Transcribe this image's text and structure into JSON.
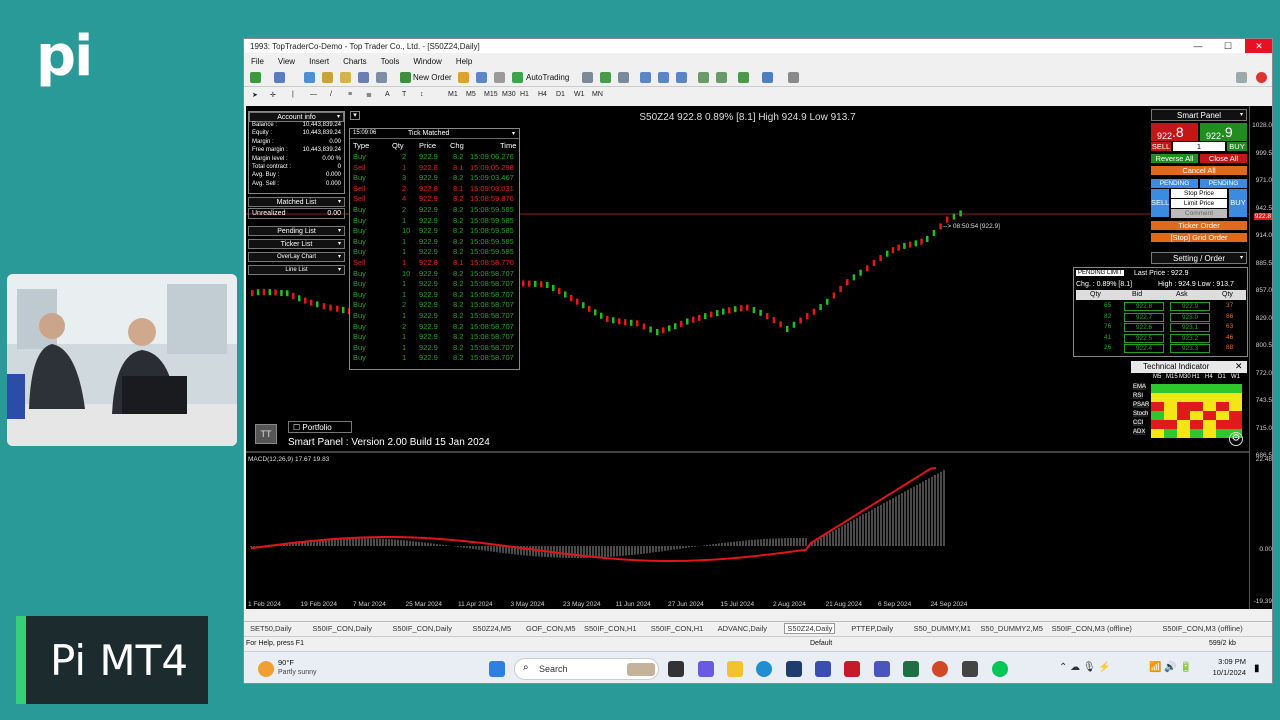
{
  "brand": {
    "logo": "pi",
    "show": "Pi MT4"
  },
  "window": {
    "title": "1993: TopTraderCo-Demo - Top Trader Co., Ltd. - [S50Z24,Daily]",
    "min": "—",
    "max": "☐",
    "close": "✕"
  },
  "menu": [
    "File",
    "View",
    "Insert",
    "Charts",
    "Tools",
    "Window",
    "Help"
  ],
  "toolbar": {
    "new_order": "New Order",
    "autotrading": "AutoTrading",
    "timeframes": [
      "M1",
      "M5",
      "M15",
      "M30",
      "H1",
      "H4",
      "D1",
      "W1",
      "MN"
    ]
  },
  "chart": {
    "header": "S50Z24 922.8 0.89% [8.1] High 924.9 Low 913.7",
    "price_scale": [
      "1028.0",
      "999.5",
      "971.0",
      "942.5",
      "914.0",
      "885.5",
      "857.0",
      "829.0",
      "800.5",
      "772.0",
      "743.5",
      "715.0",
      "686.5"
    ],
    "indicator_scale": [
      "22.48",
      "0.00",
      "-19.39"
    ],
    "current_price_label": "922.8",
    "time_label": "--> 08:50:54 [922.9]",
    "macd_label": "MACD(12,26,9) 17.67 19.83",
    "date_axis": [
      "1 Feb 2024",
      "19 Feb 2024",
      "7 Mar 2024",
      "25 Mar 2024",
      "11 Apr 2024",
      "3 May 2024",
      "23 May 2024",
      "11 Jun 2024",
      "27 Jun 2024",
      "15 Jul 2024",
      "2 Aug 2024",
      "21 Aug 2024",
      "6 Sep 2024",
      "24 Sep 2024"
    ],
    "portfolio": "Portfolio",
    "version": "Smart Panel : Version 2.00 Build 15 Jan 2024"
  },
  "account": {
    "title": "Account info",
    "rows": [
      [
        "Balance :",
        "10,443,839.24"
      ],
      [
        "Equity :",
        "10,443,839.24"
      ],
      [
        "Margin :",
        "0.00"
      ],
      [
        "Free margin :",
        "10,443,839.24"
      ],
      [
        "Margin level :",
        "0.00 %"
      ],
      [
        "Total contract :",
        "0"
      ],
      [
        "Avg. Buy :",
        "0.000"
      ],
      [
        "Avg. Sell :",
        "0.000"
      ]
    ],
    "matched": "Matched List",
    "unrealized": "Unrealized",
    "unrealized_val": "0.00",
    "pending": "Pending List",
    "ticker": "Ticker List",
    "overlay": "OverLay Chart",
    "line": "Line List"
  },
  "tick": {
    "time": "15:09:06",
    "title": "Tick Matched",
    "headers": [
      "Type",
      "Qty",
      "Price",
      "Chg",
      "Time"
    ],
    "rows": [
      [
        "Buy",
        "2",
        "922.9",
        "8.2",
        "15:09:06.276"
      ],
      [
        "Sell",
        "1",
        "922.8",
        "8.1",
        "15:09:05.298"
      ],
      [
        "Buy",
        "3",
        "922.9",
        "8.2",
        "15:09:03.467"
      ],
      [
        "Sell",
        "2",
        "922.8",
        "8.1",
        "15:09:03.031"
      ],
      [
        "Sell",
        "4",
        "922.9",
        "8.2",
        "15:08:59.876"
      ],
      [
        "Buy",
        "2",
        "922.9",
        "8.2",
        "15:08:59.585"
      ],
      [
        "Buy",
        "1",
        "922.9",
        "8.2",
        "15:08:59.585"
      ],
      [
        "Buy",
        "10",
        "922.9",
        "8.2",
        "15:08:59.585"
      ],
      [
        "Buy",
        "1",
        "922.9",
        "8.2",
        "15:08:59.585"
      ],
      [
        "Buy",
        "1",
        "922.9",
        "8.2",
        "15:08:59.585"
      ],
      [
        "Sell",
        "1",
        "922.8",
        "8.1",
        "15:08:58.770"
      ],
      [
        "Buy",
        "10",
        "922.9",
        "8.2",
        "15:08:58.707"
      ],
      [
        "Buy",
        "1",
        "922.9",
        "8.2",
        "15:08:58.707"
      ],
      [
        "Buy",
        "1",
        "922.9",
        "8.2",
        "15:08:58.707"
      ],
      [
        "Buy",
        "2",
        "922.9",
        "8.2",
        "15:08:58.707"
      ],
      [
        "Buy",
        "1",
        "922.9",
        "8.2",
        "15:08:58.707"
      ],
      [
        "Buy",
        "2",
        "922.9",
        "8.2",
        "15:08:58.707"
      ],
      [
        "Buy",
        "1",
        "922.9",
        "8.2",
        "15:08:58.707"
      ],
      [
        "Buy",
        "1",
        "922.9",
        "8.2",
        "15:08:58.707"
      ],
      [
        "Buy",
        "1",
        "922.9",
        "8.2",
        "15:08:58.707"
      ]
    ]
  },
  "smart": {
    "title": "Smart Panel",
    "sell_price": "922",
    "sell_big": ".8",
    "buy_price": "922",
    "buy_big": ".9",
    "sell": "SELL",
    "buy": "BUY",
    "qty": "1",
    "reverse": "Reverse All",
    "close_all": "Close All",
    "cancel_all": "Cancel All",
    "pending": "PENDING",
    "stop_price": "Stop Price",
    "limit_price": "Limit Price",
    "comment": "Comment",
    "ticker_order": "Ticker Order",
    "grid_order": "[Stop] Grid Order",
    "setting": "Setting / Order"
  },
  "depth": {
    "pending": "PENDING LIMIT",
    "last": "Last Price : 922.9",
    "chg": "Chg. : 0.89% [8.1]",
    "hl": "High : 924.9 Low : 913.7",
    "headers": [
      "Qty",
      "Bid",
      "Ask",
      "Qty"
    ],
    "rows": [
      [
        "65",
        "922.8",
        "922.9",
        "37"
      ],
      [
        "82",
        "922.7",
        "923.0",
        "86"
      ],
      [
        "76",
        "922.6",
        "923.1",
        "63"
      ],
      [
        "41",
        "922.5",
        "923.2",
        "46"
      ],
      [
        "26",
        "922.4",
        "923.3",
        "88"
      ]
    ]
  },
  "tech": {
    "title": "Technical Indicator",
    "tfs": [
      "M5",
      "M15",
      "M30",
      "H1",
      "H4",
      "D1",
      "W1"
    ],
    "rows": [
      "EMA",
      "RSI",
      "PSAR",
      "Stoch",
      "CCI",
      "ADX"
    ],
    "grid": [
      [
        "g",
        "g",
        "g",
        "g",
        "g",
        "g",
        "g"
      ],
      [
        "y",
        "y",
        "y",
        "y",
        "y",
        "y",
        "y"
      ],
      [
        "r",
        "y",
        "r",
        "r",
        "y",
        "r",
        "y"
      ],
      [
        "g",
        "y",
        "r",
        "y",
        "r",
        "y",
        "r"
      ],
      [
        "r",
        "r",
        "y",
        "r",
        "y",
        "r",
        "r"
      ],
      [
        "y",
        "g",
        "y",
        "g",
        "y",
        "g",
        "g"
      ]
    ],
    "colors": {
      "g": "#2ec82e",
      "y": "#f4e516",
      "r": "#e01a1a"
    }
  },
  "tabs": [
    "SET50,Daily",
    "S50IF_CON,Daily",
    "S50IF_CON,Daily",
    "S50Z24,M5",
    "GOF_CON,M5",
    "S50IF_CON,H1",
    "S50IF_CON,H1",
    "ADVANC,Daily",
    "S50Z24,Daily",
    "PTTEP,Daily",
    "S50_DUMMY,M1",
    "S50_DUMMY2,M5",
    "S50IF_CON,M3 (offline)",
    "S50IF_CON,M3 (offline)",
    "GOF_C"
  ],
  "status": {
    "help": "For Help, press F1",
    "profile": "Default",
    "net": "599/2 kb"
  },
  "taskbar": {
    "temp": "90°F",
    "weather": "Partly sunny",
    "search": "Search",
    "time": "3:09 PM",
    "date": "10/1/2024"
  }
}
